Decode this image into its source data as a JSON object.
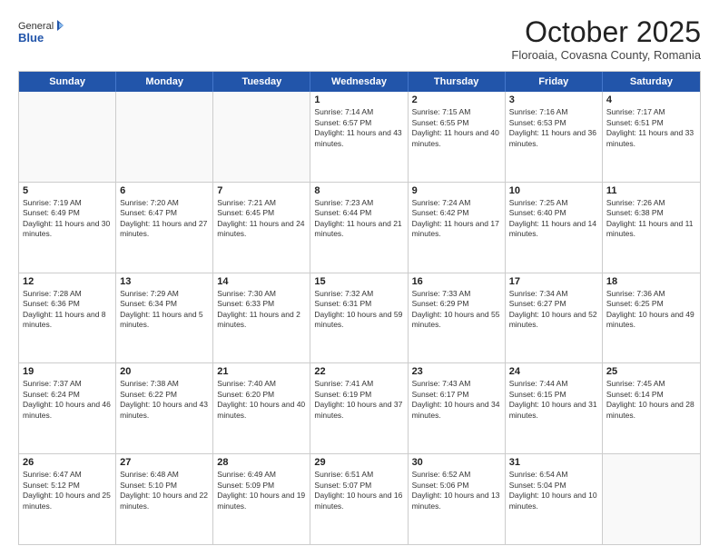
{
  "logo": {
    "general": "General",
    "blue": "Blue"
  },
  "title": "October 2025",
  "location": "Floroaia, Covasna County, Romania",
  "days_header": [
    "Sunday",
    "Monday",
    "Tuesday",
    "Wednesday",
    "Thursday",
    "Friday",
    "Saturday"
  ],
  "weeks": [
    [
      {
        "day": "",
        "info": ""
      },
      {
        "day": "",
        "info": ""
      },
      {
        "day": "",
        "info": ""
      },
      {
        "day": "1",
        "info": "Sunrise: 7:14 AM\nSunset: 6:57 PM\nDaylight: 11 hours and 43 minutes."
      },
      {
        "day": "2",
        "info": "Sunrise: 7:15 AM\nSunset: 6:55 PM\nDaylight: 11 hours and 40 minutes."
      },
      {
        "day": "3",
        "info": "Sunrise: 7:16 AM\nSunset: 6:53 PM\nDaylight: 11 hours and 36 minutes."
      },
      {
        "day": "4",
        "info": "Sunrise: 7:17 AM\nSunset: 6:51 PM\nDaylight: 11 hours and 33 minutes."
      }
    ],
    [
      {
        "day": "5",
        "info": "Sunrise: 7:19 AM\nSunset: 6:49 PM\nDaylight: 11 hours and 30 minutes."
      },
      {
        "day": "6",
        "info": "Sunrise: 7:20 AM\nSunset: 6:47 PM\nDaylight: 11 hours and 27 minutes."
      },
      {
        "day": "7",
        "info": "Sunrise: 7:21 AM\nSunset: 6:45 PM\nDaylight: 11 hours and 24 minutes."
      },
      {
        "day": "8",
        "info": "Sunrise: 7:23 AM\nSunset: 6:44 PM\nDaylight: 11 hours and 21 minutes."
      },
      {
        "day": "9",
        "info": "Sunrise: 7:24 AM\nSunset: 6:42 PM\nDaylight: 11 hours and 17 minutes."
      },
      {
        "day": "10",
        "info": "Sunrise: 7:25 AM\nSunset: 6:40 PM\nDaylight: 11 hours and 14 minutes."
      },
      {
        "day": "11",
        "info": "Sunrise: 7:26 AM\nSunset: 6:38 PM\nDaylight: 11 hours and 11 minutes."
      }
    ],
    [
      {
        "day": "12",
        "info": "Sunrise: 7:28 AM\nSunset: 6:36 PM\nDaylight: 11 hours and 8 minutes."
      },
      {
        "day": "13",
        "info": "Sunrise: 7:29 AM\nSunset: 6:34 PM\nDaylight: 11 hours and 5 minutes."
      },
      {
        "day": "14",
        "info": "Sunrise: 7:30 AM\nSunset: 6:33 PM\nDaylight: 11 hours and 2 minutes."
      },
      {
        "day": "15",
        "info": "Sunrise: 7:32 AM\nSunset: 6:31 PM\nDaylight: 10 hours and 59 minutes."
      },
      {
        "day": "16",
        "info": "Sunrise: 7:33 AM\nSunset: 6:29 PM\nDaylight: 10 hours and 55 minutes."
      },
      {
        "day": "17",
        "info": "Sunrise: 7:34 AM\nSunset: 6:27 PM\nDaylight: 10 hours and 52 minutes."
      },
      {
        "day": "18",
        "info": "Sunrise: 7:36 AM\nSunset: 6:25 PM\nDaylight: 10 hours and 49 minutes."
      }
    ],
    [
      {
        "day": "19",
        "info": "Sunrise: 7:37 AM\nSunset: 6:24 PM\nDaylight: 10 hours and 46 minutes."
      },
      {
        "day": "20",
        "info": "Sunrise: 7:38 AM\nSunset: 6:22 PM\nDaylight: 10 hours and 43 minutes."
      },
      {
        "day": "21",
        "info": "Sunrise: 7:40 AM\nSunset: 6:20 PM\nDaylight: 10 hours and 40 minutes."
      },
      {
        "day": "22",
        "info": "Sunrise: 7:41 AM\nSunset: 6:19 PM\nDaylight: 10 hours and 37 minutes."
      },
      {
        "day": "23",
        "info": "Sunrise: 7:43 AM\nSunset: 6:17 PM\nDaylight: 10 hours and 34 minutes."
      },
      {
        "day": "24",
        "info": "Sunrise: 7:44 AM\nSunset: 6:15 PM\nDaylight: 10 hours and 31 minutes."
      },
      {
        "day": "25",
        "info": "Sunrise: 7:45 AM\nSunset: 6:14 PM\nDaylight: 10 hours and 28 minutes."
      }
    ],
    [
      {
        "day": "26",
        "info": "Sunrise: 6:47 AM\nSunset: 5:12 PM\nDaylight: 10 hours and 25 minutes."
      },
      {
        "day": "27",
        "info": "Sunrise: 6:48 AM\nSunset: 5:10 PM\nDaylight: 10 hours and 22 minutes."
      },
      {
        "day": "28",
        "info": "Sunrise: 6:49 AM\nSunset: 5:09 PM\nDaylight: 10 hours and 19 minutes."
      },
      {
        "day": "29",
        "info": "Sunrise: 6:51 AM\nSunset: 5:07 PM\nDaylight: 10 hours and 16 minutes."
      },
      {
        "day": "30",
        "info": "Sunrise: 6:52 AM\nSunset: 5:06 PM\nDaylight: 10 hours and 13 minutes."
      },
      {
        "day": "31",
        "info": "Sunrise: 6:54 AM\nSunset: 5:04 PM\nDaylight: 10 hours and 10 minutes."
      },
      {
        "day": "",
        "info": ""
      }
    ]
  ]
}
